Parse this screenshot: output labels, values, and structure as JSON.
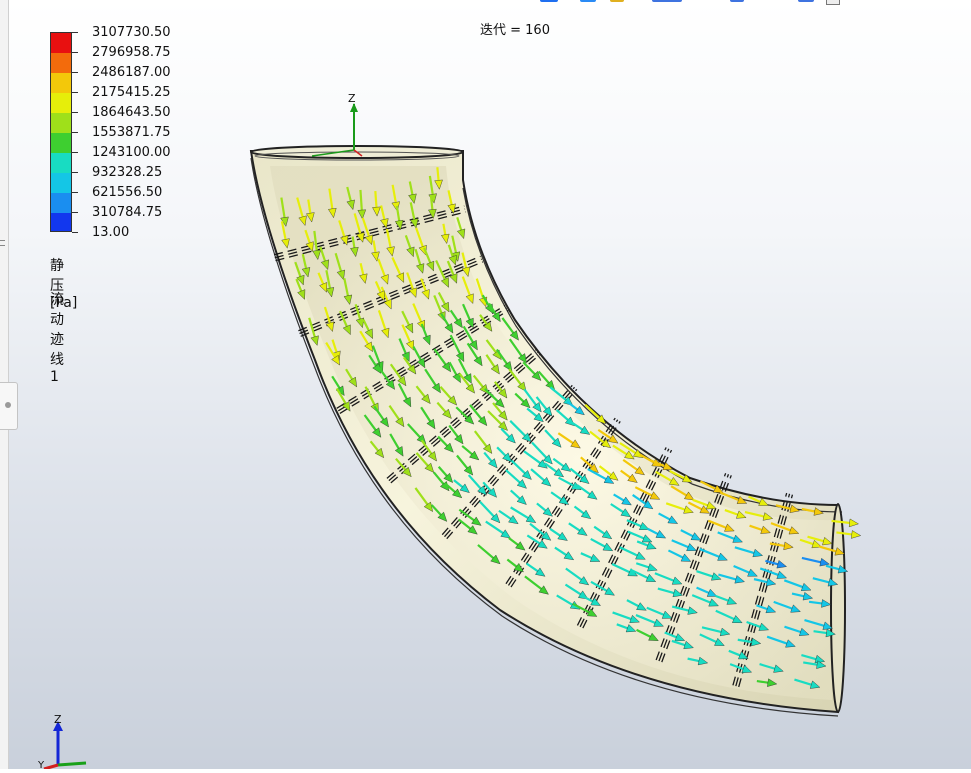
{
  "iteration": "迭代 = 160",
  "legend": {
    "title": "静压 [Pa]",
    "subtitle": "流动迹线 1",
    "labels": [
      "3107730.50",
      "2796958.75",
      "2486187.00",
      "2175415.25",
      "1864643.50",
      "1553871.75",
      "1243100.00",
      "932328.25",
      "621556.50",
      "310784.75",
      "13.00"
    ],
    "colors": [
      "#e81010",
      "#f36b0c",
      "#f3c80a",
      "#e6ee0a",
      "#9fe01a",
      "#3ecf30",
      "#18dcc2",
      "#14c6e6",
      "#1a8ef0",
      "#1237ee"
    ]
  },
  "axis": {
    "z": "Z",
    "y": "Y"
  },
  "icons": {
    "triad": "axis-triad-icon",
    "origin": "coordinate-origin-icon"
  }
}
